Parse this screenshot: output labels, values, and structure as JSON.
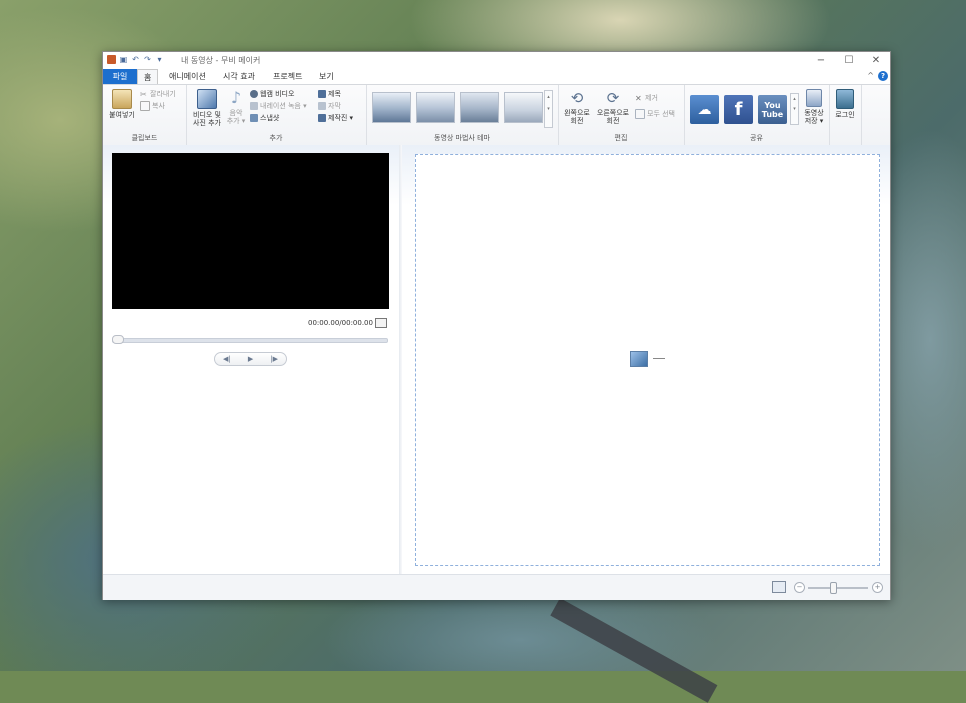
{
  "window": {
    "title": "내 동영상 - 무비 메이커",
    "minimize": "−",
    "maximize": "☐",
    "close": "✕"
  },
  "tabs": [
    "파일",
    "홈",
    "애니메이션",
    "시각 효과",
    "프로젝트",
    "보기"
  ],
  "ribbon": {
    "clipboard": {
      "label": "클립보드",
      "paste": "붙여넣기",
      "cut": "잘라내기",
      "copy": "복사"
    },
    "add": {
      "label": "추가",
      "add_video_line1": "비디오 및",
      "add_video_line2": "사진 추가",
      "add_music_line1": "음악",
      "add_music_line2": "추가 ▾",
      "webcam": "웹캠 비디오",
      "narration": "내레이션 녹음 ▾",
      "snapshot": "스냅샷",
      "title": "제목",
      "caption": "자막",
      "credits": "제작진 ▾"
    },
    "themes": {
      "label": "동영상 마법사 테마"
    },
    "edit": {
      "label": "편집",
      "rotate_left_line1": "왼쪽으로",
      "rotate_left_line2": "회전",
      "rotate_right_line1": "오른쪽으로",
      "rotate_right_line2": "회전",
      "remove": "제거",
      "select_all": "모두 선택"
    },
    "share": {
      "label": "공유",
      "youtube_line1": "You",
      "youtube_line2": "Tube",
      "save_line1": "동영상",
      "save_line2": "저장 ▾",
      "signin": "로그인"
    }
  },
  "preview": {
    "timecode": "00:00.00/00:00.00",
    "prev_frame": "◀|",
    "play": "▶",
    "next_frame": "|▶"
  },
  "storyboard": {
    "placeholder_dash": "—"
  },
  "statusbar": {
    "zoom_out": "−",
    "zoom_in": "+"
  },
  "colors": {
    "file_tab": "#1d6fce",
    "storyboard_border": "#8fb0dc"
  }
}
